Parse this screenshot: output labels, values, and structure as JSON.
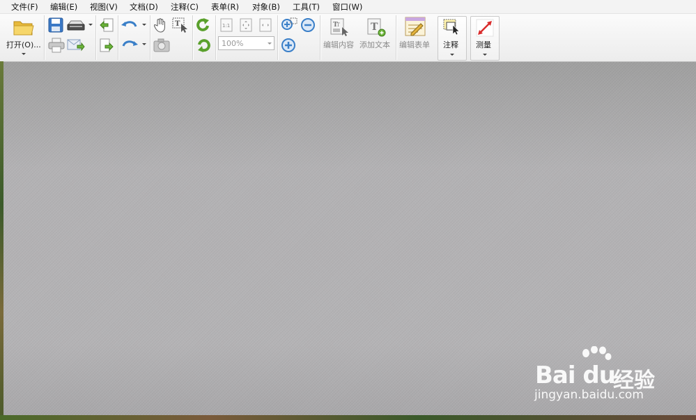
{
  "menu": [
    {
      "id": "file",
      "label": "文件(F)"
    },
    {
      "id": "edit",
      "label": "编辑(E)"
    },
    {
      "id": "view",
      "label": "视图(V)"
    },
    {
      "id": "document",
      "label": "文档(D)"
    },
    {
      "id": "comment",
      "label": "注释(C)"
    },
    {
      "id": "form",
      "label": "表单(R)"
    },
    {
      "id": "object",
      "label": "对象(B)"
    },
    {
      "id": "tools",
      "label": "工具(T)"
    },
    {
      "id": "window",
      "label": "窗口(W)"
    }
  ],
  "toolbar": {
    "open_label": "打开(O)...",
    "zoom_value": "100%",
    "edit_content_label": "编辑内容",
    "add_text_label": "添加文本",
    "edit_form_label": "编辑表单",
    "annotate_label": "注释",
    "measure_label": "测量"
  },
  "watermark": {
    "brand": "Bai du",
    "product": "经验",
    "url": "jingyan.baidu.com"
  },
  "colors": {
    "accent_green": "#5aa02c",
    "accent_blue": "#3a7fc8",
    "measure_red": "#d92b2b",
    "folder_yellow": "#f0c040"
  }
}
